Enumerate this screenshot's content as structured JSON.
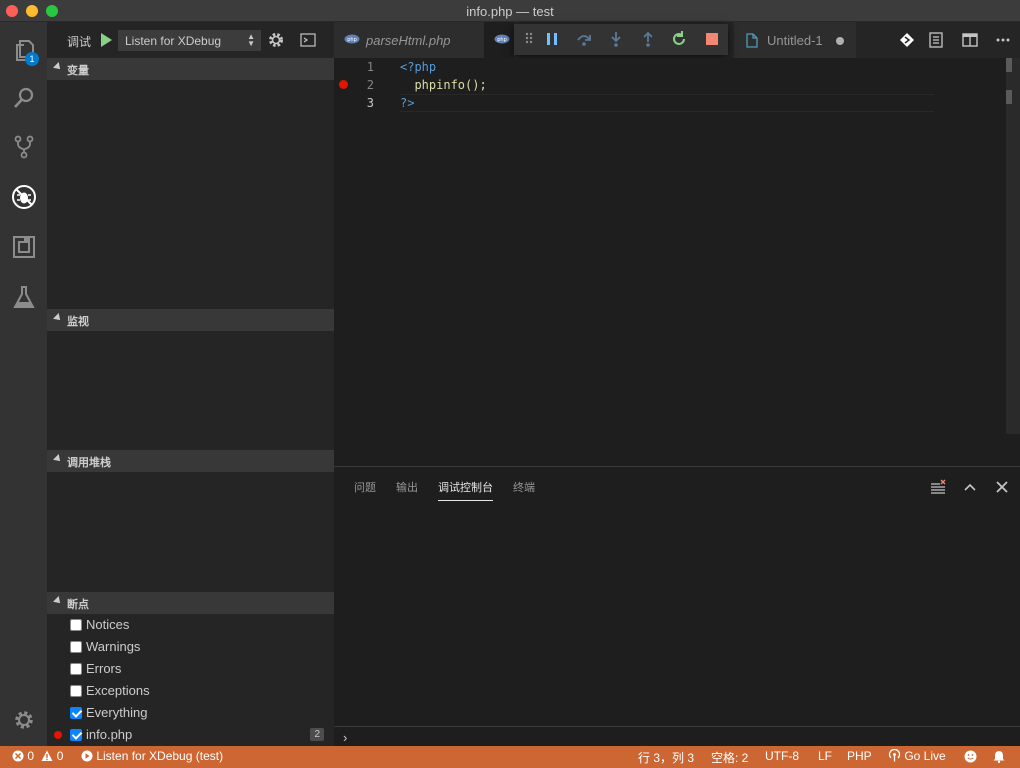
{
  "window": {
    "title": "info.php — test"
  },
  "activity_bar": {
    "explorer_badge": "1"
  },
  "debug": {
    "label": "调试",
    "configuration": "Listen for XDebug"
  },
  "sections": {
    "variables": "变量",
    "watch": "监视",
    "call_stack": "调用堆栈",
    "breakpoints": "断点"
  },
  "breakpoints": [
    {
      "label": "Notices",
      "checked": false
    },
    {
      "label": "Warnings",
      "checked": false
    },
    {
      "label": "Errors",
      "checked": false
    },
    {
      "label": "Exceptions",
      "checked": false
    },
    {
      "label": "Everything",
      "checked": true
    }
  ],
  "file_breakpoint": {
    "label": "info.php",
    "count": "2"
  },
  "tabs": {
    "parse": "parseHtml.php",
    "untitled": "Untitled-1"
  },
  "editor": {
    "lines": [
      {
        "num": "1",
        "text": "<?php"
      },
      {
        "num": "2",
        "text": "  phpinfo();"
      },
      {
        "num": "3",
        "text": "?>"
      }
    ]
  },
  "panel": {
    "tabs": [
      "问题",
      "输出",
      "调试控制台",
      "终端"
    ],
    "active_tab": "调试控制台",
    "prompt": "›"
  },
  "status": {
    "errors": "0",
    "warnings": "0",
    "debug_session": "Listen for XDebug (test)",
    "position": "行 3，列 3",
    "indent": "空格: 2",
    "encoding": "UTF-8",
    "eol": "LF",
    "language": "PHP",
    "go_live": "Go Live"
  },
  "colors": {
    "status_bar": "#cc6633",
    "breakpoint": "#e51400",
    "accent": "#007acc"
  }
}
